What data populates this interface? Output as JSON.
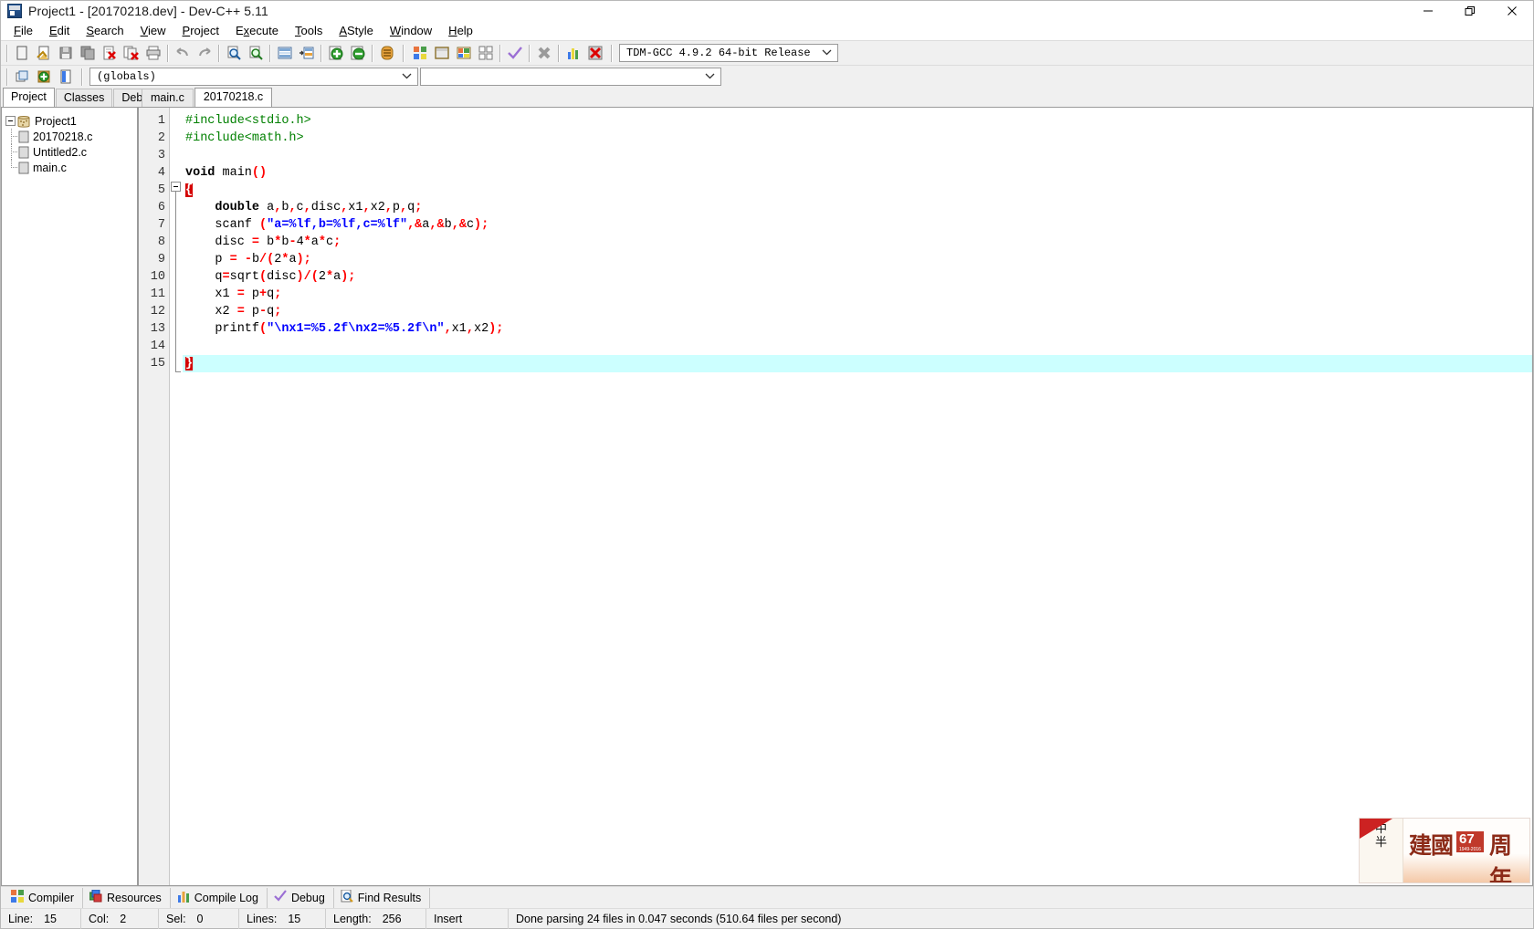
{
  "window": {
    "title": "Project1 - [20170218.dev] - Dev-C++ 5.11",
    "app_icon": "devcpp-icon",
    "controls": {
      "minimize": "minimize-icon",
      "restore": "restore-icon",
      "close": "close-icon"
    }
  },
  "menubar": {
    "items": [
      {
        "label": "File",
        "accel": "F"
      },
      {
        "label": "Edit",
        "accel": "E"
      },
      {
        "label": "Search",
        "accel": "S"
      },
      {
        "label": "View",
        "accel": "V"
      },
      {
        "label": "Project",
        "accel": "P"
      },
      {
        "label": "Execute",
        "accel": "x"
      },
      {
        "label": "Tools",
        "accel": "T"
      },
      {
        "label": "AStyle",
        "accel": "A"
      },
      {
        "label": "Window",
        "accel": "W"
      },
      {
        "label": "Help",
        "accel": "H"
      }
    ]
  },
  "toolbar_main": {
    "buttons": [
      "new-file-icon",
      "open-file-icon",
      "save-file-icon",
      "save-all-icon",
      "close-file-icon",
      "close-all-icon",
      "print-icon",
      "undo-icon",
      "redo-icon",
      "find-icon",
      "replace-icon",
      "goto-line-icon",
      "goto-function-icon",
      "add-to-project-icon",
      "remove-from-project-icon",
      "project-options-icon",
      "compile-icon",
      "run-icon",
      "compile-and-run-icon",
      "rebuild-all-icon",
      "syntax-check-icon",
      "stop-execution-icon",
      "profile-icon",
      "debug-icon"
    ],
    "compiler_select": {
      "value": "TDM-GCC 4.9.2 64-bit Release",
      "arrow": "chevron-down-icon"
    }
  },
  "toolbar_secondary": {
    "buttons": [
      "insert-icon",
      "toggle-breakpoint-icon",
      "goto-class-browser-icon"
    ],
    "globals_select": {
      "value": "(globals)",
      "arrow": "chevron-down-icon"
    },
    "member_select": {
      "value": "",
      "arrow": "chevron-down-icon"
    }
  },
  "left_panel": {
    "tabs": [
      {
        "label": "Project",
        "active": true
      },
      {
        "label": "Classes",
        "active": false
      },
      {
        "label": "Debug",
        "active": false
      }
    ],
    "tree": {
      "root": {
        "label": "Project1",
        "icon": "project-icon",
        "expander": "collapse-icon"
      },
      "files": [
        {
          "label": "20170218.c",
          "icon": "c-file-icon"
        },
        {
          "label": "Untitled2.c",
          "icon": "c-file-icon"
        },
        {
          "label": "main.c",
          "icon": "c-file-icon"
        }
      ]
    }
  },
  "editor": {
    "tabs": [
      {
        "label": "main.c",
        "active": false
      },
      {
        "label": "20170218.c",
        "active": true
      }
    ],
    "current_line": 15,
    "lines": [
      {
        "n": 1,
        "tokens": [
          {
            "t": "#include<stdio.h>",
            "c": "pre"
          }
        ]
      },
      {
        "n": 2,
        "tokens": [
          {
            "t": "#include<math.h>",
            "c": "pre"
          }
        ]
      },
      {
        "n": 3,
        "tokens": []
      },
      {
        "n": 4,
        "tokens": [
          {
            "t": "void",
            "c": "kw"
          },
          {
            "t": " main",
            "c": "plain"
          },
          {
            "t": "()",
            "c": "punc"
          }
        ]
      },
      {
        "n": 5,
        "tokens": [
          {
            "t": "{",
            "c": "brace-hl"
          }
        ]
      },
      {
        "n": 6,
        "tokens": [
          {
            "t": "    double",
            "c": "kw"
          },
          {
            "t": " a",
            "c": "plain"
          },
          {
            "t": ",",
            "c": "punc"
          },
          {
            "t": "b",
            "c": "plain"
          },
          {
            "t": ",",
            "c": "punc"
          },
          {
            "t": "c",
            "c": "plain"
          },
          {
            "t": ",",
            "c": "punc"
          },
          {
            "t": "disc",
            "c": "plain"
          },
          {
            "t": ",",
            "c": "punc"
          },
          {
            "t": "x1",
            "c": "plain"
          },
          {
            "t": ",",
            "c": "punc"
          },
          {
            "t": "x2",
            "c": "plain"
          },
          {
            "t": ",",
            "c": "punc"
          },
          {
            "t": "p",
            "c": "plain"
          },
          {
            "t": ",",
            "c": "punc"
          },
          {
            "t": "q",
            "c": "plain"
          },
          {
            "t": ";",
            "c": "punc"
          }
        ]
      },
      {
        "n": 7,
        "tokens": [
          {
            "t": "    scanf ",
            "c": "plain"
          },
          {
            "t": "(",
            "c": "punc"
          },
          {
            "t": "\"a=%lf,b=%lf,c=%lf\"",
            "c": "str"
          },
          {
            "t": ",",
            "c": "punc"
          },
          {
            "t": "&",
            "c": "punc"
          },
          {
            "t": "a",
            "c": "plain"
          },
          {
            "t": ",",
            "c": "punc"
          },
          {
            "t": "&",
            "c": "punc"
          },
          {
            "t": "b",
            "c": "plain"
          },
          {
            "t": ",",
            "c": "punc"
          },
          {
            "t": "&",
            "c": "punc"
          },
          {
            "t": "c",
            "c": "plain"
          },
          {
            "t": ");",
            "c": "punc"
          }
        ]
      },
      {
        "n": 8,
        "tokens": [
          {
            "t": "    disc ",
            "c": "plain"
          },
          {
            "t": "=",
            "c": "punc"
          },
          {
            "t": " b",
            "c": "plain"
          },
          {
            "t": "*",
            "c": "punc"
          },
          {
            "t": "b",
            "c": "plain"
          },
          {
            "t": "-",
            "c": "punc"
          },
          {
            "t": "4",
            "c": "plain"
          },
          {
            "t": "*",
            "c": "punc"
          },
          {
            "t": "a",
            "c": "plain"
          },
          {
            "t": "*",
            "c": "punc"
          },
          {
            "t": "c",
            "c": "plain"
          },
          {
            "t": ";",
            "c": "punc"
          }
        ]
      },
      {
        "n": 9,
        "tokens": [
          {
            "t": "    p ",
            "c": "plain"
          },
          {
            "t": "=",
            "c": "punc"
          },
          {
            "t": " ",
            "c": "plain"
          },
          {
            "t": "-",
            "c": "punc"
          },
          {
            "t": "b",
            "c": "plain"
          },
          {
            "t": "/(",
            "c": "punc"
          },
          {
            "t": "2",
            "c": "plain"
          },
          {
            "t": "*",
            "c": "punc"
          },
          {
            "t": "a",
            "c": "plain"
          },
          {
            "t": ");",
            "c": "punc"
          }
        ]
      },
      {
        "n": 10,
        "tokens": [
          {
            "t": "    q",
            "c": "plain"
          },
          {
            "t": "=",
            "c": "punc"
          },
          {
            "t": "sqrt",
            "c": "plain"
          },
          {
            "t": "(",
            "c": "punc"
          },
          {
            "t": "disc",
            "c": "plain"
          },
          {
            "t": ")/(",
            "c": "punc"
          },
          {
            "t": "2",
            "c": "plain"
          },
          {
            "t": "*",
            "c": "punc"
          },
          {
            "t": "a",
            "c": "plain"
          },
          {
            "t": ");",
            "c": "punc"
          }
        ]
      },
      {
        "n": 11,
        "tokens": [
          {
            "t": "    x1 ",
            "c": "plain"
          },
          {
            "t": "=",
            "c": "punc"
          },
          {
            "t": " p",
            "c": "plain"
          },
          {
            "t": "+",
            "c": "punc"
          },
          {
            "t": "q",
            "c": "plain"
          },
          {
            "t": ";",
            "c": "punc"
          }
        ]
      },
      {
        "n": 12,
        "tokens": [
          {
            "t": "    x2 ",
            "c": "plain"
          },
          {
            "t": "=",
            "c": "punc"
          },
          {
            "t": " p",
            "c": "plain"
          },
          {
            "t": "-",
            "c": "punc"
          },
          {
            "t": "q",
            "c": "plain"
          },
          {
            "t": ";",
            "c": "punc"
          }
        ]
      },
      {
        "n": 13,
        "tokens": [
          {
            "t": "    printf",
            "c": "plain"
          },
          {
            "t": "(",
            "c": "punc"
          },
          {
            "t": "\"\\nx1=%5.2f\\nx2=%5.2f\\n\"",
            "c": "str"
          },
          {
            "t": ",",
            "c": "punc"
          },
          {
            "t": "x1",
            "c": "plain"
          },
          {
            "t": ",",
            "c": "punc"
          },
          {
            "t": "x2",
            "c": "plain"
          },
          {
            "t": ");",
            "c": "punc"
          }
        ]
      },
      {
        "n": 14,
        "tokens": []
      },
      {
        "n": 15,
        "tokens": [
          {
            "t": "}",
            "c": "brace-hl"
          }
        ]
      }
    ]
  },
  "watermark": {
    "side_text": "中\n半",
    "main_text": "建國",
    "badge": "67",
    "badge_sub": "1949-2016",
    "suffix_text": "周年"
  },
  "bottom_tabs": [
    {
      "label": "Compiler",
      "icon": "compiler-icon"
    },
    {
      "label": "Resources",
      "icon": "resources-icon"
    },
    {
      "label": "Compile Log",
      "icon": "compile-log-icon"
    },
    {
      "label": "Debug",
      "icon": "debug-check-icon"
    },
    {
      "label": "Find Results",
      "icon": "find-results-icon"
    }
  ],
  "statusbar": {
    "line_label": "Line:",
    "line_value": "15",
    "col_label": "Col:",
    "col_value": "2",
    "sel_label": "Sel:",
    "sel_value": "0",
    "lines_label": "Lines:",
    "lines_value": "15",
    "length_label": "Length:",
    "length_value": "256",
    "mode": "Insert",
    "message": "Done parsing 24 files in 0.047 seconds (510.64 files per second)"
  },
  "colors": {
    "accent_red": "#ff0000",
    "string_blue": "#0000ff",
    "preprocessor_green": "#008000",
    "current_line": "#ccffff",
    "brace_highlight": "#d40000",
    "window_bg": "#f0f0f0"
  }
}
